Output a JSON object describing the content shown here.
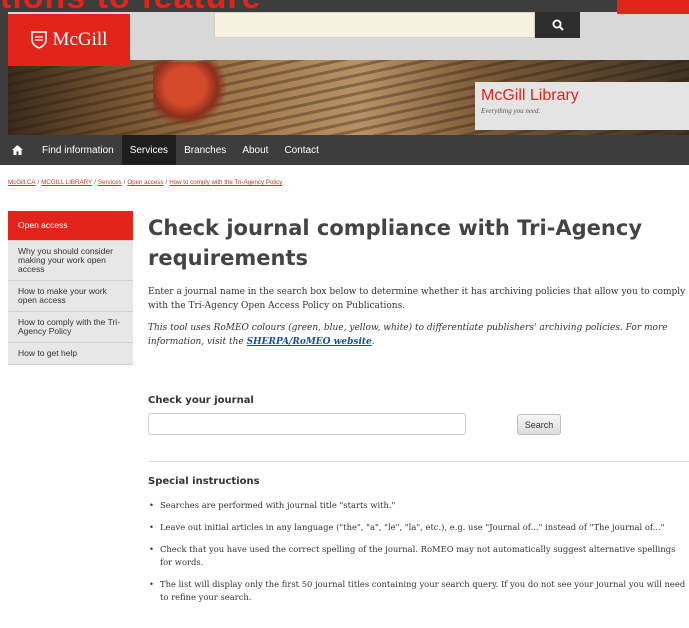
{
  "overlay_text": "tions to feature",
  "header": {
    "logo_text": "McGill",
    "library_title": "McGill Library",
    "library_tagline": "Everything you need."
  },
  "nav": {
    "items": [
      {
        "label": "Find information"
      },
      {
        "label": "Services"
      },
      {
        "label": "Branches"
      },
      {
        "label": "About"
      },
      {
        "label": "Contact"
      }
    ]
  },
  "breadcrumb": [
    "McGill.CA",
    "MCGILL LIBRARY",
    "Services",
    "Open access",
    "How to comply with the Tri-Agency Policy"
  ],
  "sidebar": {
    "items": [
      {
        "label": "Open access"
      },
      {
        "label": "Why you should consider making your work open access"
      },
      {
        "label": "How to make your work open access"
      },
      {
        "label": "How to comply with the Tri-Agency Policy"
      },
      {
        "label": "How to get help"
      }
    ]
  },
  "main": {
    "title": "Check journal compliance with Tri-Agency requirements",
    "intro_line1": "Enter a journal name in the search box below to determine whether it has archiving policies that allow you to comply",
    "intro_line2": "with the Tri-Agency Open Access Policy on Publications.",
    "intro2_text": "This tool uses RoMEO colours (green, blue, yellow, white) to differentiate publishers' archiving policies. For more information, visit the ",
    "intro2_link": "SHERPA/RoMEO website",
    "intro2_end": "."
  },
  "check": {
    "heading": "Check your journal",
    "input_value": "",
    "button_label": "Search"
  },
  "special": {
    "heading": "Special instructions",
    "items": [
      "Searches are performed with journal title \"starts with.\"",
      "Leave out initial articles in any language (\"the\", \"a\", \"le\", \"la\", etc.), e.g. use \"Journal of...\" instead of \"The journal of...\"",
      "Check that you have used the correct spelling of the journal. RoMEO may not automatically suggest alternative spellings for words.",
      "The list will display only the first 50 journal titles containing your search query. If you do not see your journal you will need to refine your search."
    ]
  }
}
